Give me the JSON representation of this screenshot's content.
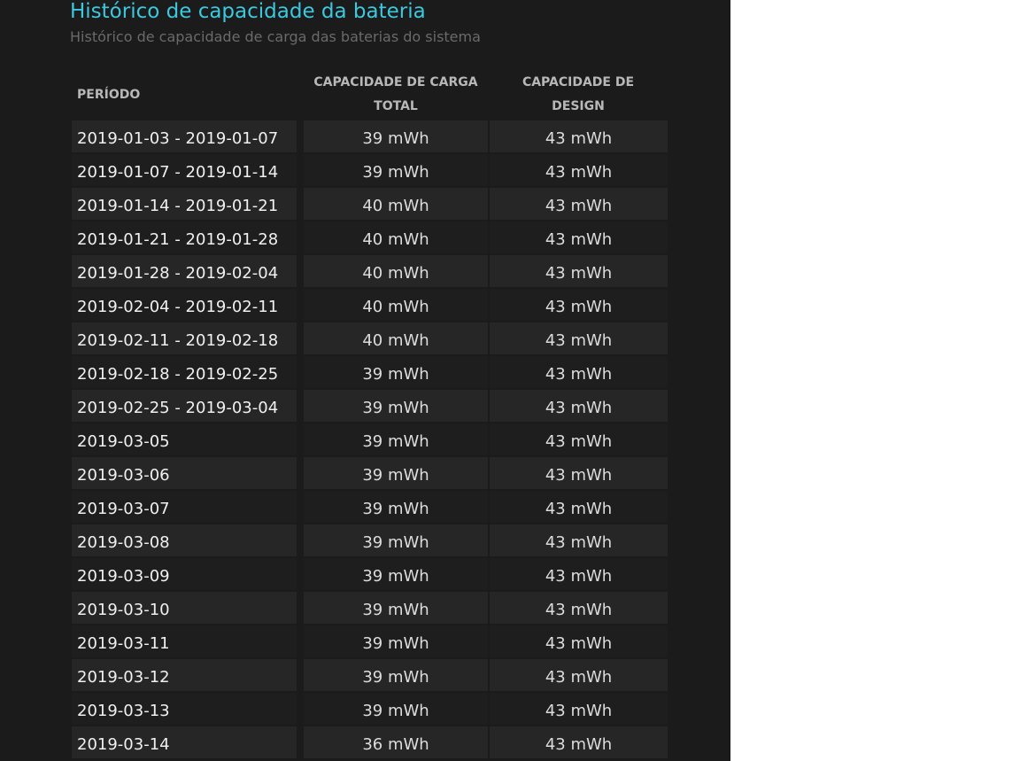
{
  "page": {
    "title": "Histórico de capacidade da bateria",
    "subtitle": "Histórico de capacidade de carga das baterias do sistema"
  },
  "table": {
    "headers": {
      "period": "PERÍODO",
      "full_charge_line1": "CAPACIDADE DE CARGA",
      "full_charge_line2": "TOTAL",
      "design_line1": "CAPACIDADE DE",
      "design_line2": "DESIGN"
    },
    "rows": [
      {
        "period": "2019-01-03 - 2019-01-07",
        "full_charge": "39 mWh",
        "design": "43 mWh"
      },
      {
        "period": "2019-01-07 - 2019-01-14",
        "full_charge": "39 mWh",
        "design": "43 mWh"
      },
      {
        "period": "2019-01-14 - 2019-01-21",
        "full_charge": "40 mWh",
        "design": "43 mWh"
      },
      {
        "period": "2019-01-21 - 2019-01-28",
        "full_charge": "40 mWh",
        "design": "43 mWh"
      },
      {
        "period": "2019-01-28 - 2019-02-04",
        "full_charge": "40 mWh",
        "design": "43 mWh"
      },
      {
        "period": "2019-02-04 - 2019-02-11",
        "full_charge": "40 mWh",
        "design": "43 mWh"
      },
      {
        "period": "2019-02-11 - 2019-02-18",
        "full_charge": "40 mWh",
        "design": "43 mWh"
      },
      {
        "period": "2019-02-18 - 2019-02-25",
        "full_charge": "39 mWh",
        "design": "43 mWh"
      },
      {
        "period": "2019-02-25 - 2019-03-04",
        "full_charge": "39 mWh",
        "design": "43 mWh"
      },
      {
        "period": "2019-03-05",
        "full_charge": "39 mWh",
        "design": "43 mWh"
      },
      {
        "period": "2019-03-06",
        "full_charge": "39 mWh",
        "design": "43 mWh"
      },
      {
        "period": "2019-03-07",
        "full_charge": "39 mWh",
        "design": "43 mWh"
      },
      {
        "period": "2019-03-08",
        "full_charge": "39 mWh",
        "design": "43 mWh"
      },
      {
        "period": "2019-03-09",
        "full_charge": "39 mWh",
        "design": "43 mWh"
      },
      {
        "period": "2019-03-10",
        "full_charge": "39 mWh",
        "design": "43 mWh"
      },
      {
        "period": "2019-03-11",
        "full_charge": "39 mWh",
        "design": "43 mWh"
      },
      {
        "period": "2019-03-12",
        "full_charge": "39 mWh",
        "design": "43 mWh"
      },
      {
        "period": "2019-03-13",
        "full_charge": "39 mWh",
        "design": "43 mWh"
      },
      {
        "period": "2019-03-14",
        "full_charge": "36 mWh",
        "design": "43 mWh"
      }
    ]
  },
  "colors": {
    "panel_background": "#1b1b1b",
    "title_accent": "#3cc8de",
    "subtitle": "#6a6a6a",
    "header_text": "#b8b8b8",
    "row_odd": "#262626",
    "row_even": "#1e1e1e"
  }
}
